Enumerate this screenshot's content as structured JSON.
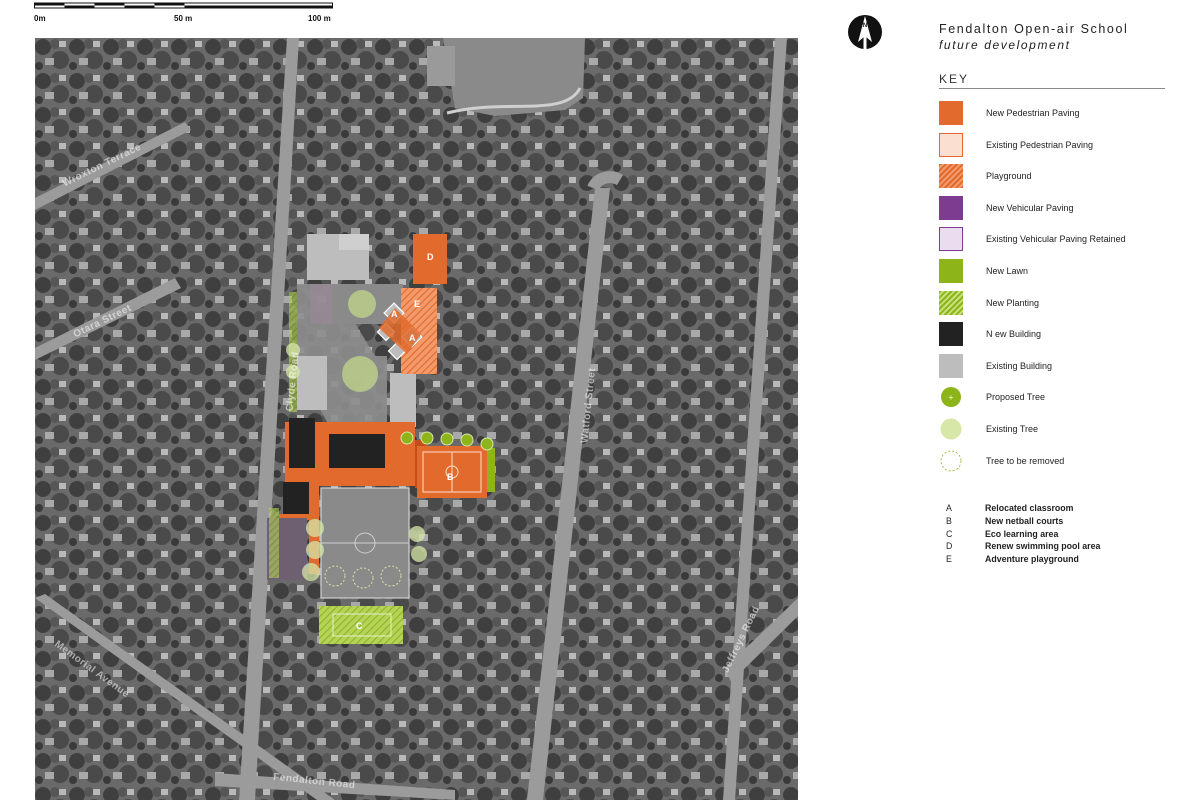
{
  "title": "Fendalton Open-air School",
  "subtitle": "future development",
  "key_heading": "KEY",
  "scale_bar": {
    "labels": [
      "0m",
      "50 m",
      "100 m"
    ]
  },
  "street_labels": [
    "Clyde Road",
    "Fendalton Road",
    "Memorial Avenue",
    "Wroxton Terrace",
    "Otara Street",
    "Watford Street",
    "Jeffreys Road"
  ],
  "zone_letters": [
    "A",
    "A",
    "B",
    "C",
    "D",
    "E"
  ],
  "legend": [
    {
      "label": "New Pedestrian Paving",
      "swatch": "solid",
      "fill": "#e26a2c",
      "stroke": "#e26a2c"
    },
    {
      "label": "Existing Pedestrian Paving",
      "swatch": "outline",
      "fill": "#fbe0d1",
      "stroke": "#e26a2c"
    },
    {
      "label": "Playground",
      "swatch": "hatch",
      "fill": "#e26a2c",
      "stroke": "#e26a2c"
    },
    {
      "label": "New Vehicular Paving",
      "swatch": "solid",
      "fill": "#7d3c8f",
      "stroke": "#7d3c8f"
    },
    {
      "label": "Existing Vehicular Paving Retained",
      "swatch": "outline",
      "fill": "#ecdcef",
      "stroke": "#7d3c8f"
    },
    {
      "label": "New Lawn",
      "swatch": "solid",
      "fill": "#8db51a",
      "stroke": "#8db51a"
    },
    {
      "label": "New Planting",
      "swatch": "hatch",
      "fill": "#8db51a",
      "stroke": "#8db51a"
    },
    {
      "label": "N ew Building",
      "swatch": "solid",
      "fill": "#222222",
      "stroke": "#222222"
    },
    {
      "label": "Existing Building",
      "swatch": "solid",
      "fill": "#bdbdbd",
      "stroke": "#bdbdbd"
    },
    {
      "label": "Proposed Tree",
      "swatch": "tree-new",
      "fill": "#8db51a",
      "stroke": "#8db51a"
    },
    {
      "label": "Existing Tree",
      "swatch": "tree-existing",
      "fill": "#d6e7a8",
      "stroke": "#d6e7a8"
    },
    {
      "label": "Tree to be removed",
      "swatch": "tree-removed",
      "fill": "#ffffff",
      "stroke": "#8db51a"
    }
  ],
  "notes": [
    {
      "letter": "A",
      "text": "Relocated classroom"
    },
    {
      "letter": "B",
      "text": "New netball courts"
    },
    {
      "letter": "C",
      "text": "Eco learning area"
    },
    {
      "letter": "D",
      "text": "Renew swimming pool area"
    },
    {
      "letter": "E",
      "text": "Adventure playground"
    }
  ],
  "colors": {
    "orange": "#e26a2c",
    "purple": "#7d3c8f",
    "green": "#8db51a",
    "new_building": "#222222",
    "existing_building": "#bdbdbd"
  }
}
